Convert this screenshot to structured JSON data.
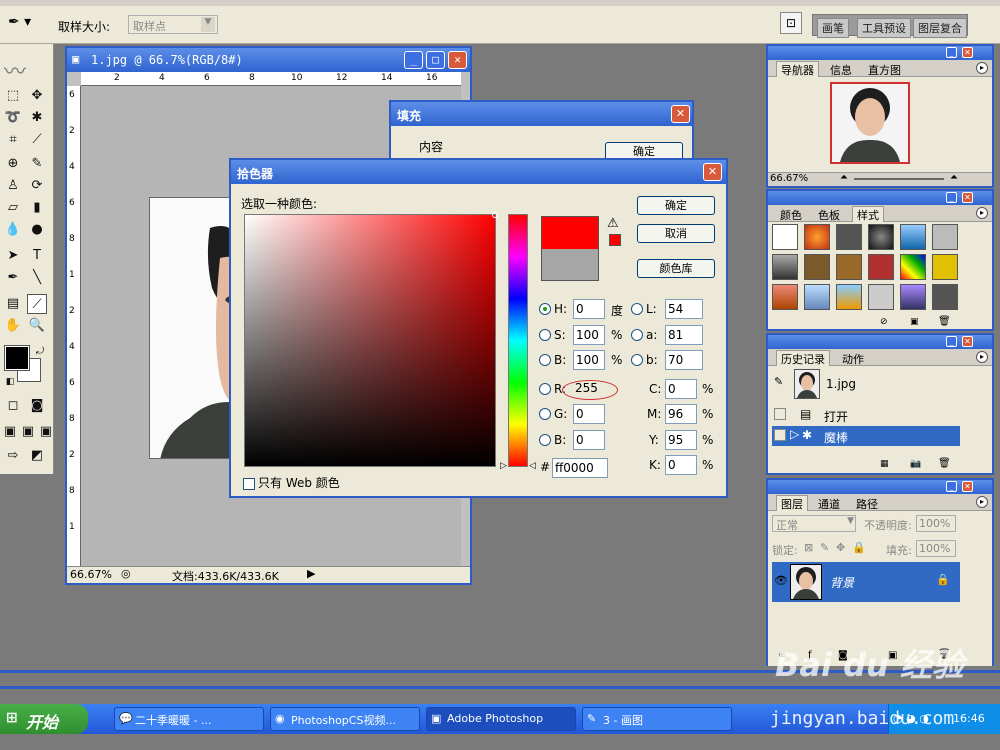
{
  "options_bar": {
    "sample_size_label": "取样大小:",
    "sample_size_value": "取样点",
    "well_tabs": [
      "画笔",
      "工具预设",
      "图层复合"
    ]
  },
  "document": {
    "title": "1.jpg @ 66.7%(RGB/8#)",
    "zoom": "66.67%",
    "doc_size": "文档:433.6K/433.6K",
    "ruler_h": [
      "2",
      "4",
      "6",
      "8",
      "10",
      "12",
      "14",
      "16"
    ],
    "ruler_v": [
      "6",
      "2",
      "4",
      "6",
      "8",
      "1",
      "2",
      "4",
      "6",
      "8",
      "2",
      "8",
      "1"
    ]
  },
  "fill_dialog": {
    "title": "填充",
    "content_label": "内容",
    "ok": "确定"
  },
  "color_picker": {
    "title": "拾色器",
    "prompt": "选取一种颜色:",
    "buttons": {
      "ok": "确定",
      "cancel": "取消",
      "library": "颜色库"
    },
    "fields": {
      "H": "0",
      "S": "100",
      "B": "100",
      "R": "255",
      "G": "0",
      "B2": "0",
      "L": "54",
      "a": "81",
      "b": "70",
      "C": "0",
      "M": "96",
      "Y": "95",
      "K": "0"
    },
    "units": {
      "degree": "度",
      "percent": "%"
    },
    "hex_label": "#",
    "hex": "ff0000",
    "web_only": "只有 Web 颜色",
    "new_color": "#ff0000",
    "old_color": "#a6a6a6"
  },
  "navigator_panel": {
    "tabs": [
      "导航器",
      "信息",
      "直方图"
    ],
    "zoom": "66.67%"
  },
  "styles_panel": {
    "tabs": [
      "颜色",
      "色板",
      "样式"
    ]
  },
  "history_panel": {
    "tabs": [
      "历史记录",
      "动作"
    ],
    "snapshot": "1.jpg",
    "items": [
      "打开",
      "魔棒"
    ]
  },
  "layers_panel": {
    "tabs": [
      "图层",
      "通道",
      "路径"
    ],
    "blend_mode": "正常",
    "opacity_label": "不透明度:",
    "opacity": "100%",
    "lock_label": "锁定:",
    "fill_label": "填充:",
    "fill": "100%",
    "layer_name": "背景"
  },
  "taskbar": {
    "start": "开始",
    "tasks": [
      "二十季暖暖 - ...",
      "PhotoshopCS视频...",
      "Adobe Photoshop",
      "3 - 画图"
    ],
    "clock": "16:46"
  },
  "watermark": {
    "logo": "Bai du 经验",
    "url": "jingyan.baidu.com"
  }
}
